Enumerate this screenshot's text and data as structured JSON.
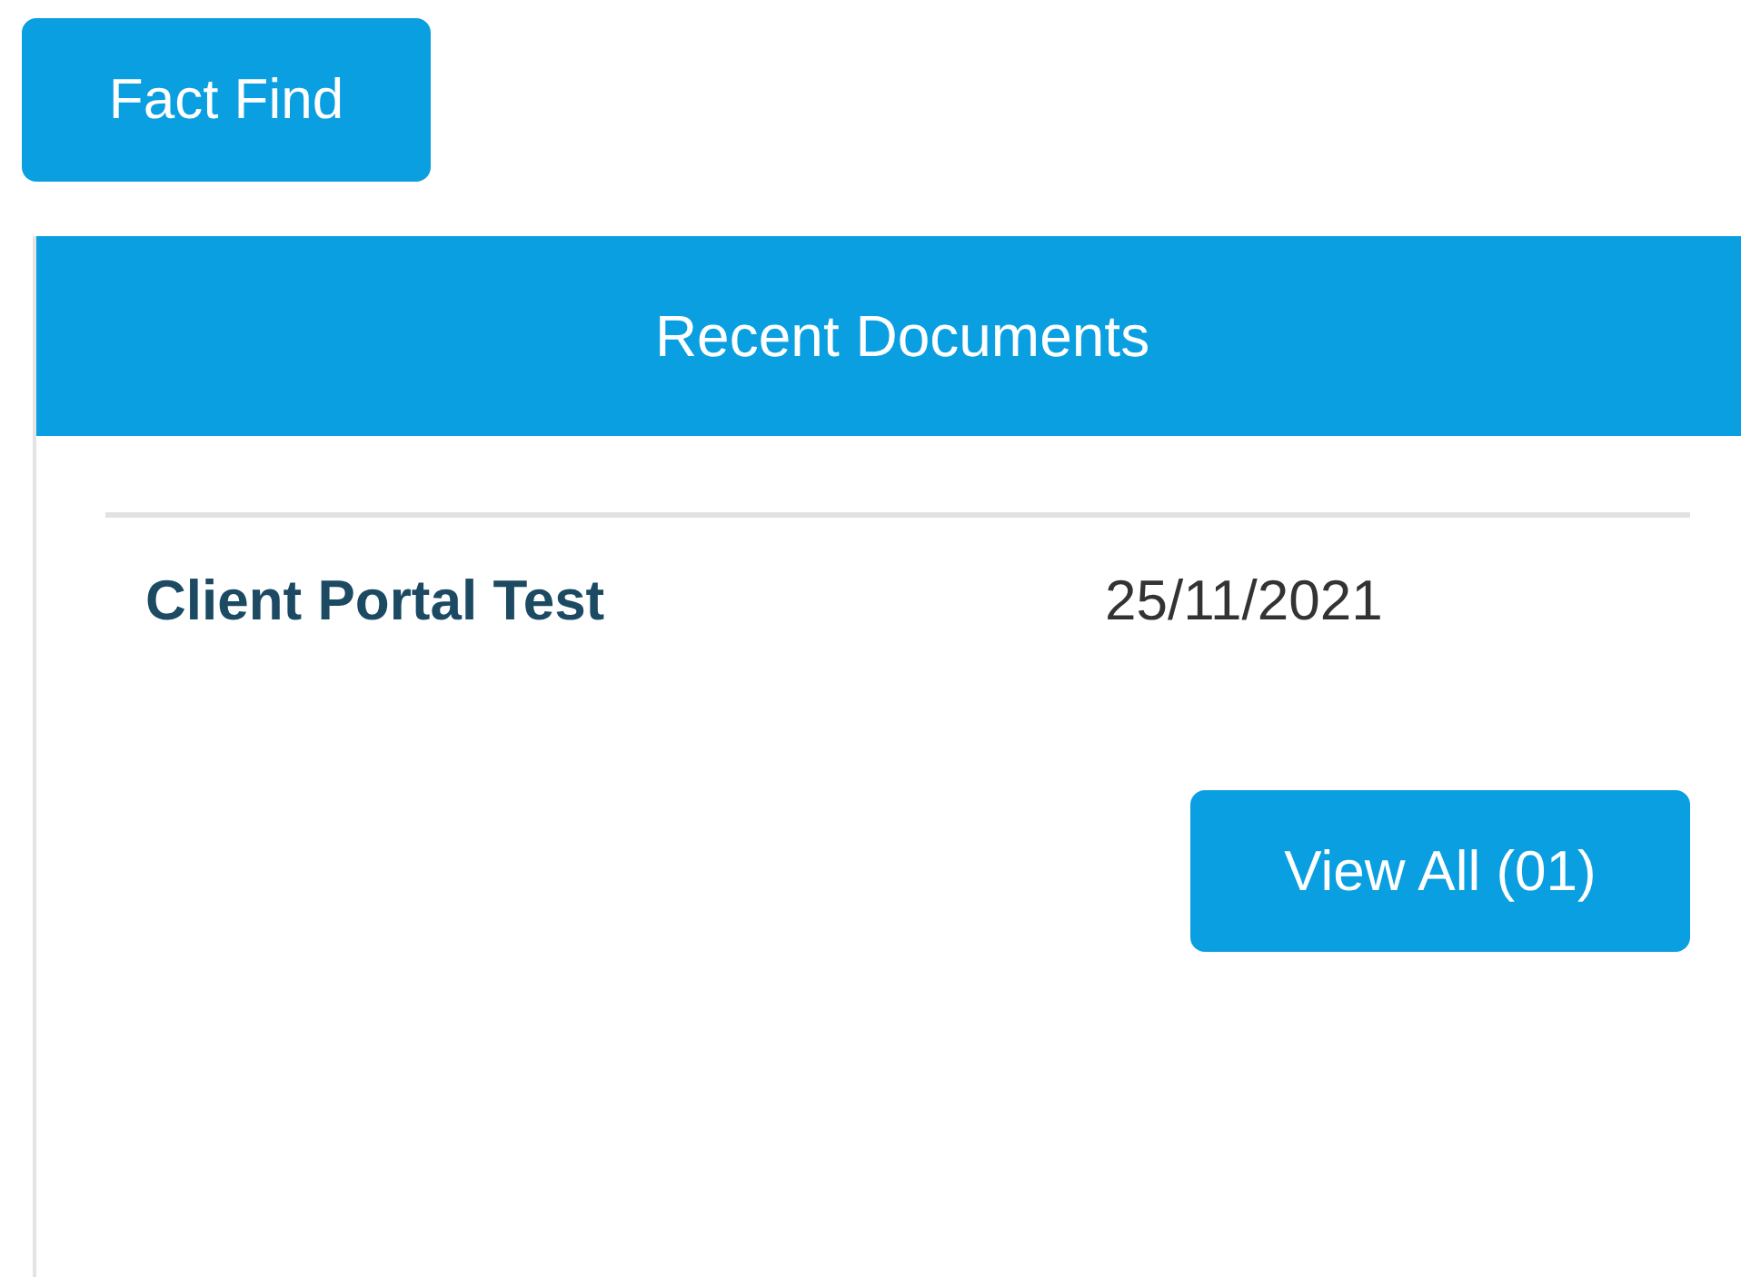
{
  "fact_find_button": "Fact Find",
  "recent_documents": {
    "title": "Recent Documents",
    "rows": [
      {
        "name": "Client Portal Test",
        "date": "25/11/2021"
      }
    ],
    "view_all_button": "View All (01)"
  }
}
